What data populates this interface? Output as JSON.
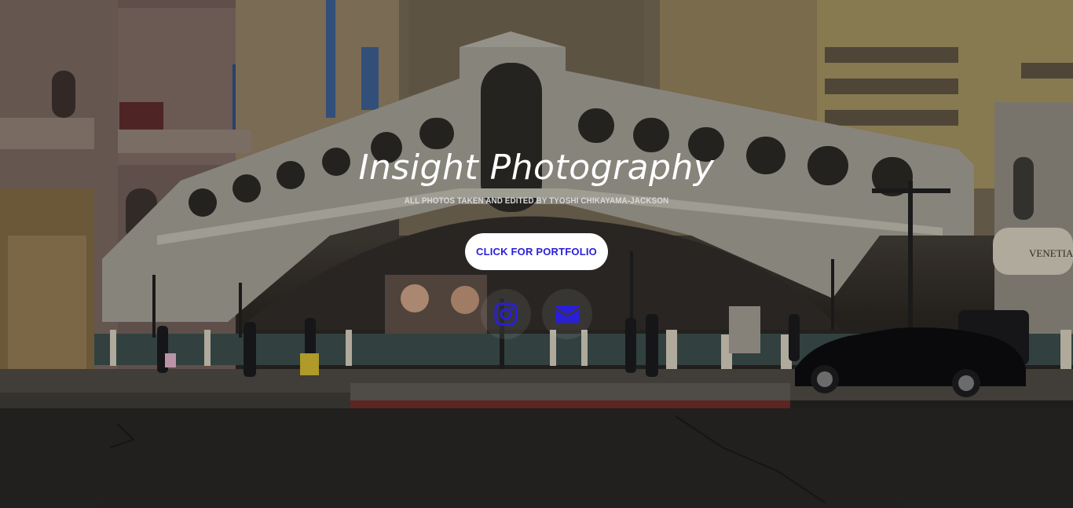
{
  "hero": {
    "title": "Insight Photography",
    "subtitle": "ALL PHOTOS TAKEN AND EDITED BY TYOSHI CHIKAYAMA-JACKSON",
    "cta_label": "CLICK FOR PORTFOLIO"
  },
  "social": [
    {
      "icon": "instagram-icon"
    },
    {
      "icon": "envelope-icon"
    }
  ],
  "background": {
    "sign_text": "VENETIAN"
  },
  "colors": {
    "accent": "#2a1fd8",
    "title": "#ffffff",
    "button_bg": "#ffffff"
  }
}
